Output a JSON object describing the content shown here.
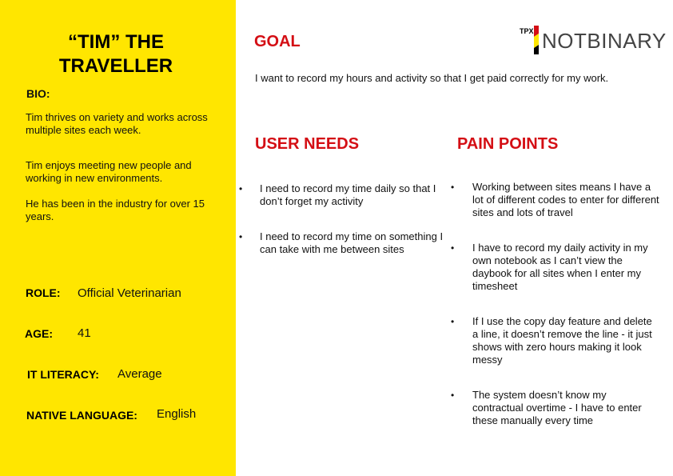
{
  "persona": {
    "title_line1": "“TIM” THE",
    "title_line2": "TRAVELLER",
    "bio_label": "BIO:",
    "bio": [
      "Tim thrives on variety and works across multiple sites each week.",
      "Tim enjoys meeting new people and working in new environments.",
      "He has been in the industry for over 15 years."
    ],
    "role_label": "ROLE:",
    "role": "Official Veterinarian",
    "age_label": "AGE:",
    "age": "41",
    "it_literacy_label": "IT LITERACY:",
    "it_literacy": "Average",
    "native_language_label": "NATIVE LANGUAGE:",
    "native_language": "English"
  },
  "goal": {
    "heading": "GOAL",
    "text": "I want to record my hours and activity so that I get paid correctly for my work."
  },
  "logo": {
    "prefix": "TPX",
    "name": "NOTBINARY",
    "accent_colors": [
      "#D40E14",
      "#FFE600",
      "#000000"
    ]
  },
  "user_needs": {
    "heading": "USER NEEDS",
    "items": [
      "I need to record my time daily so that I don’t forget my activity",
      "I need to record my time on something I can take with me between sites"
    ]
  },
  "pain_points": {
    "heading": "PAIN POINTS",
    "items": [
      "Working between sites means I have a lot of different codes to enter for different sites and lots of travel",
      "I have to record my daily activity in my own notebook as I can’t view the daybook for all sites when I enter my timesheet",
      "If I use the copy day feature and delete a line, it doesn’t remove the line - it just shows with zero hours making it look messy",
      "The system doesn’t know my contractual overtime - I have to enter these manually every time"
    ]
  },
  "bullet_char": "•",
  "colors": {
    "sidebar": "#FFE600",
    "heading_red": "#D40E14"
  }
}
